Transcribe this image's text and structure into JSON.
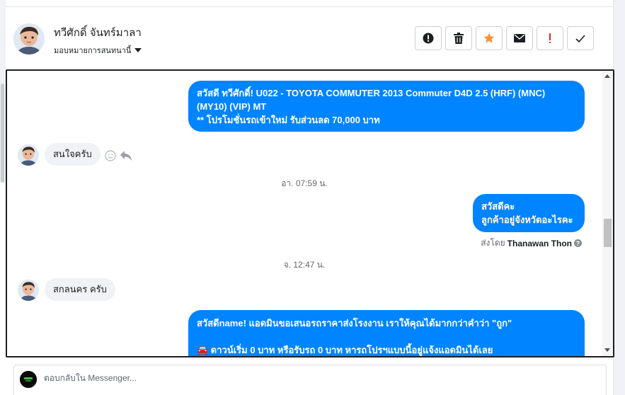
{
  "header": {
    "contact_name": "ทวีศักดิ์ จันทร์มาลา",
    "assign_label": "มอบหมายการสนทนานี้",
    "actions": [
      {
        "name": "report-button",
        "icon": "exclamation-circle-icon"
      },
      {
        "name": "delete-button",
        "icon": "trash-icon"
      },
      {
        "name": "star-button",
        "icon": "star-icon",
        "color": "#f7923a"
      },
      {
        "name": "mark-unread-button",
        "icon": "envelope-icon"
      },
      {
        "name": "important-button",
        "icon": "exclamation-icon",
        "color": "#e02424"
      },
      {
        "name": "mark-done-button",
        "icon": "checkmark-icon"
      }
    ]
  },
  "chat": {
    "messages": [
      {
        "type": "out",
        "lines": [
          "สวัสดี ทวีศักดิ์! U022 -  TOYOTA COMMUTER 2013 Commuter D4D 2.5 (HRF) (MNC)",
          "(MY10) (VIP) MT",
          "** โปรโมชั่นรถเข้าใหม่ รับส่วนลด 70,000 บาท"
        ]
      },
      {
        "type": "in",
        "text": "สนใจครับ"
      },
      {
        "type": "timestamp",
        "text": "อา. 07:59 น."
      },
      {
        "type": "out",
        "lines": [
          "สวัสดีคะ",
          "ลูกค้าอยู่จังหวัดอะไรคะ"
        ],
        "sent_by_label": "ส่งโดย",
        "sent_by_agent": "Thanawan Thon"
      },
      {
        "type": "timestamp",
        "text": "จ. 12:47 น."
      },
      {
        "type": "in",
        "text": "สกลนคร ครับ"
      },
      {
        "type": "out",
        "lines": [
          "สวัสดีname! แอดมินขอเสนอรถราคาส่งโรงงาน เราให้คุณได้มากกว่าคำว่า \"ถูก\"",
          "",
          "🚘 ดาวน์เริ่ม 0 บาท หรือรับรถ 0 บาท หารถโปรฯแบบนี้อยู่แจ้งแอดมินได้เลย"
        ]
      }
    ],
    "accent": "#0084ff"
  },
  "reply": {
    "placeholder": "ตอบกลับใน Messenger..."
  }
}
